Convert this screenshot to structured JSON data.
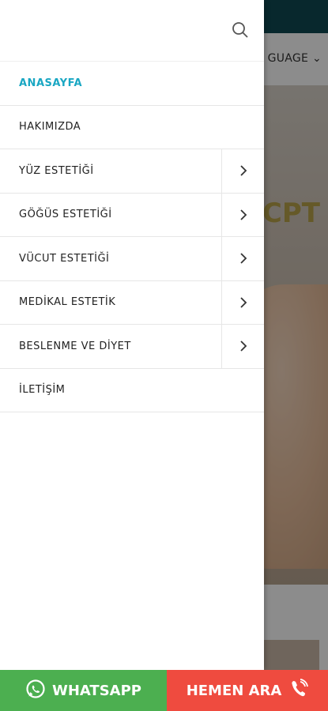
{
  "background": {
    "language_label": "GUAGE",
    "hero_text": "CPT"
  },
  "drawer": {
    "search_icon": "search-icon",
    "menu": [
      {
        "label": "ANASAYFA",
        "active": true,
        "has_submenu": false
      },
      {
        "label": "HAKIMIZDA",
        "active": false,
        "has_submenu": false
      },
      {
        "label": "YÜZ ESTETİĞİ",
        "active": false,
        "has_submenu": true
      },
      {
        "label": "GÖĞÜS ESTETİĞİ",
        "active": false,
        "has_submenu": true
      },
      {
        "label": "VÜCUT ESTETİĞİ",
        "active": false,
        "has_submenu": true
      },
      {
        "label": "MEDİKAL ESTETİK",
        "active": false,
        "has_submenu": true
      },
      {
        "label": "BESLENME VE DİYET",
        "active": false,
        "has_submenu": true
      },
      {
        "label": "İLETİŞİM",
        "active": false,
        "has_submenu": false
      }
    ]
  },
  "cta": {
    "whatsapp_label": "WHATSAPP",
    "call_label": "HEMEN ARA"
  },
  "colors": {
    "accent": "#1aa7c3",
    "whatsapp": "#4caf50",
    "call": "#ef4b3f",
    "topbar": "#0f4a52"
  }
}
